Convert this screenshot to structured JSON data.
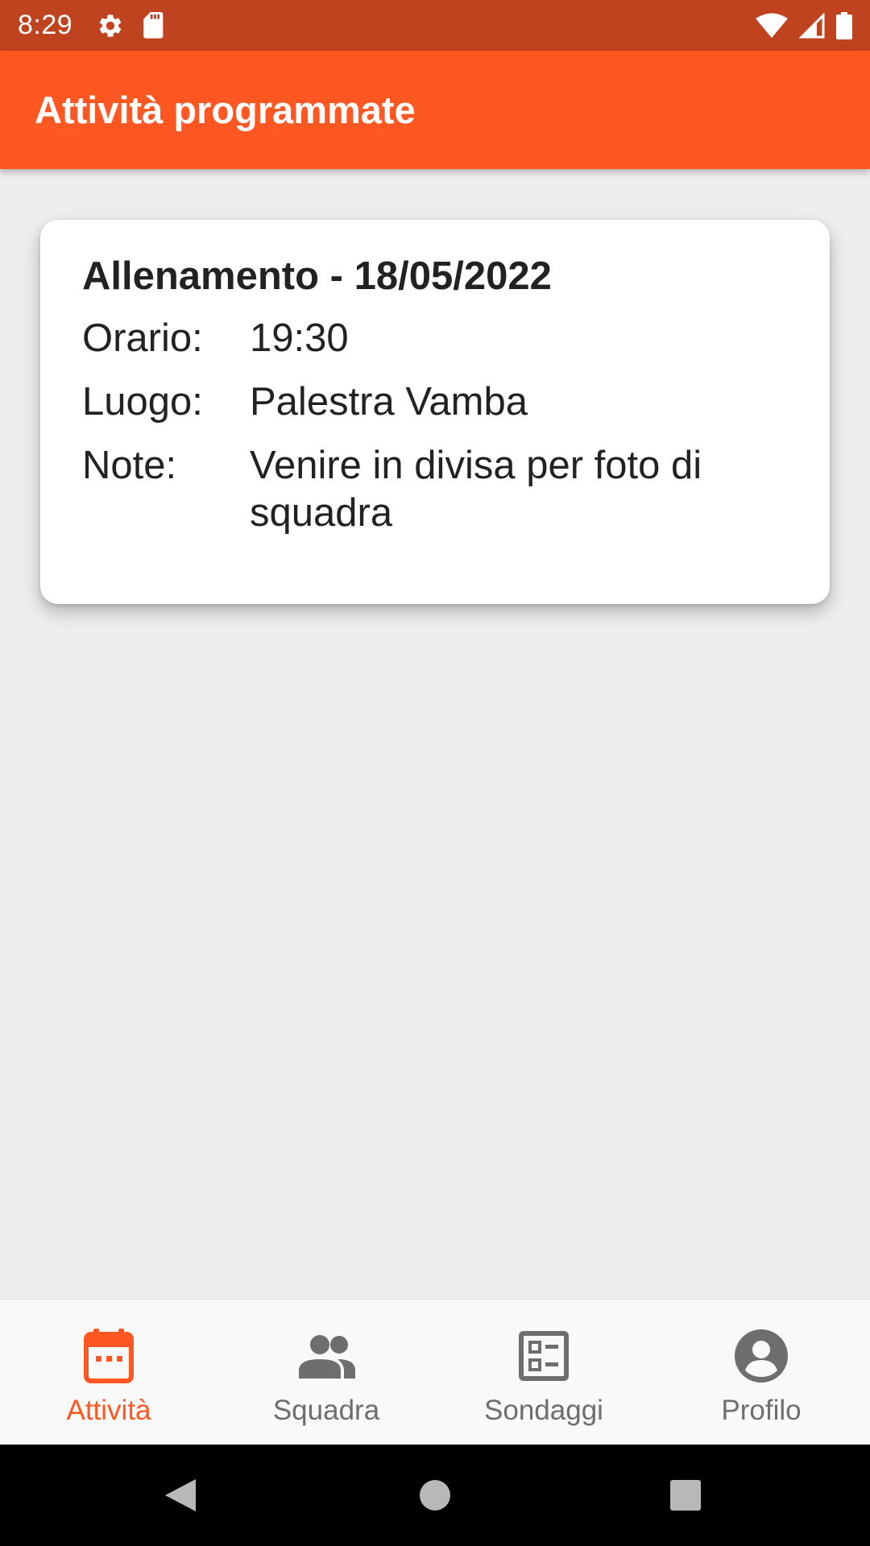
{
  "status_bar": {
    "time": "8:29",
    "icons": [
      "gear-icon",
      "sd-card-icon",
      "wifi-icon",
      "signal-icon",
      "battery-icon"
    ]
  },
  "app_bar": {
    "title": "Attività programmate",
    "color": "#ff5722"
  },
  "activity_card": {
    "title": "Allenamento - 18/05/2022",
    "rows": [
      {
        "label": "Orario:",
        "value": "19:30"
      },
      {
        "label": "Luogo:",
        "value": "Palestra Vamba"
      },
      {
        "label": "Note:",
        "value": "Venire in divisa per foto di squadra"
      }
    ]
  },
  "bottom_nav": {
    "active_color": "#ff5722",
    "inactive_color": "#6e6e6e",
    "items": [
      {
        "label": "Attività",
        "icon": "calendar-icon",
        "active": true
      },
      {
        "label": "Squadra",
        "icon": "group-icon",
        "active": false
      },
      {
        "label": "Sondaggi",
        "icon": "poll-list-icon",
        "active": false
      },
      {
        "label": "Profilo",
        "icon": "account-circle-icon",
        "active": false
      }
    ]
  },
  "system_nav": {
    "buttons": [
      "back-icon",
      "home-icon",
      "recents-icon"
    ]
  }
}
